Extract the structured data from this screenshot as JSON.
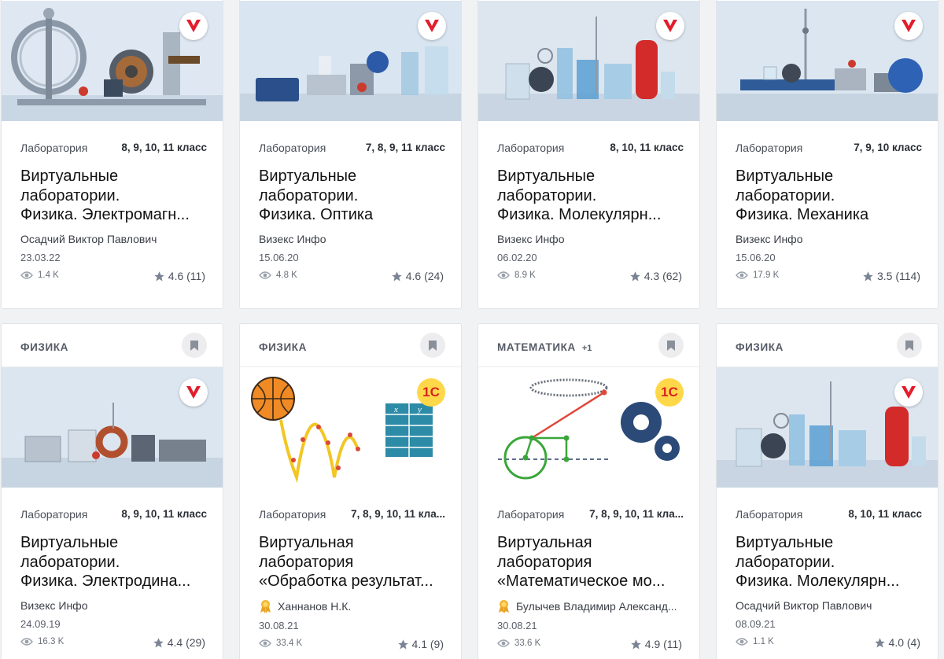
{
  "colors": {
    "accent_red": "#e21d2c",
    "card_bg": "#ffffff",
    "muted": "#6b707a"
  },
  "icons": {
    "bookmark": "bookmark-icon",
    "views": "eye-icon",
    "rating": "star-icon",
    "award": "award-icon"
  },
  "row1": [
    {
      "type": "Лаборатория",
      "grade": "8, 9, 10, 11 класс",
      "title_lines": [
        "Виртуальные",
        "лаборатории.",
        "Физика. Электромагн..."
      ],
      "author": "Осадчий Виктор Павлович",
      "date": "23.03.22",
      "views": "1.4 K",
      "rating": "4.6 (11)"
    },
    {
      "type": "Лаборатория",
      "grade": "7, 8, 9, 11 класс",
      "title_lines": [
        "Виртуальные",
        "лаборатории.",
        "Физика. Оптика"
      ],
      "author": "Визекс Инфо",
      "date": "15.06.20",
      "views": "4.8 K",
      "rating": "4.6 (24)"
    },
    {
      "type": "Лаборатория",
      "grade": "8, 10, 11 класс",
      "title_lines": [
        "Виртуальные",
        "лаборатории.",
        "Физика. Молекулярн..."
      ],
      "author": "Визекс Инфо",
      "date": "06.02.20",
      "views": "8.9 K",
      "rating": "4.3 (62)"
    },
    {
      "type": "Лаборатория",
      "grade": "7, 9, 10 класс",
      "title_lines": [
        "Виртуальные",
        "лаборатории.",
        "Физика. Механика"
      ],
      "author": "Визекс Инфо",
      "date": "15.06.20",
      "views": "17.9 K",
      "rating": "3.5 (114)"
    }
  ],
  "row2": [
    {
      "subject": "ФИЗИКА",
      "subject_extra": "",
      "type": "Лаборатория",
      "grade": "8, 9, 10, 11 класс",
      "title_lines": [
        "Виртуальные",
        "лаборатории.",
        "Физика. Электродина..."
      ],
      "author": "Визекс Инфо",
      "date": "24.09.19",
      "views": "16.3 K",
      "rating": "4.4 (29)"
    },
    {
      "subject": "ФИЗИКА",
      "subject_extra": "",
      "type": "Лаборатория",
      "grade": "7, 8, 9, 10, 11 кла...",
      "title_lines": [
        "Виртуальная",
        "лаборатория",
        "«Обработка результат..."
      ],
      "author": "Ханнанов Н.К.",
      "date": "30.08.21",
      "views": "33.4 K",
      "rating": "4.1 (9)"
    },
    {
      "subject": "МАТЕМАТИКА",
      "subject_extra": "+1",
      "type": "Лаборатория",
      "grade": "7, 8, 9, 10, 11 кла...",
      "title_lines": [
        "Виртуальная",
        "лаборатория",
        "«Математическое мо..."
      ],
      "author": "Булычев Владимир Александ...",
      "date": "30.08.21",
      "views": "33.6 K",
      "rating": "4.9 (11)"
    },
    {
      "subject": "ФИЗИКА",
      "subject_extra": "",
      "type": "Лаборатория",
      "grade": "8, 10, 11 класс",
      "title_lines": [
        "Виртуальные",
        "лаборатории.",
        "Физика. Молекулярн..."
      ],
      "author": "Осадчий Виктор Павлович",
      "date": "08.09.21",
      "views": "1.1 K",
      "rating": "4.0 (4)"
    }
  ],
  "badge_1c_label": "1С"
}
